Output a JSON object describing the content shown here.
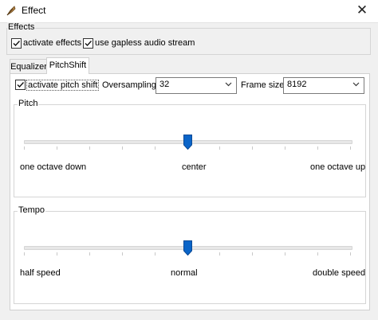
{
  "window": {
    "title": "Effect",
    "close_glyph": "✕"
  },
  "effects_group": {
    "label": "Effects",
    "activate_effects": {
      "label": "activate effects",
      "checked": true
    },
    "gapless": {
      "label": "use gapless audio stream",
      "checked": true
    }
  },
  "tabs": [
    {
      "label": "Equalizer",
      "active": false
    },
    {
      "label": "PitchShift",
      "active": true
    }
  ],
  "pitchshift": {
    "activate": {
      "label": "activate pitch shift",
      "checked": true
    },
    "oversampling": {
      "label": "Oversampling:",
      "value": "32"
    },
    "frame_size": {
      "label": "Frame size:",
      "value": "8192"
    },
    "pitch": {
      "label": "Pitch",
      "min_label": "one octave down",
      "mid_label": "center",
      "max_label": "one octave up",
      "position": 0.5
    },
    "tempo": {
      "label": "Tempo",
      "min_label": "half speed",
      "mid_label": "normal",
      "max_label": "double speed",
      "position": 0.5
    }
  },
  "colors": {
    "accent": "#0a64c8",
    "panel": "#f0f0f0"
  },
  "icons": {
    "app": "feather-icon",
    "check": "check-icon",
    "dropdown": "chevron-down-icon",
    "thumb": "slider-thumb"
  }
}
